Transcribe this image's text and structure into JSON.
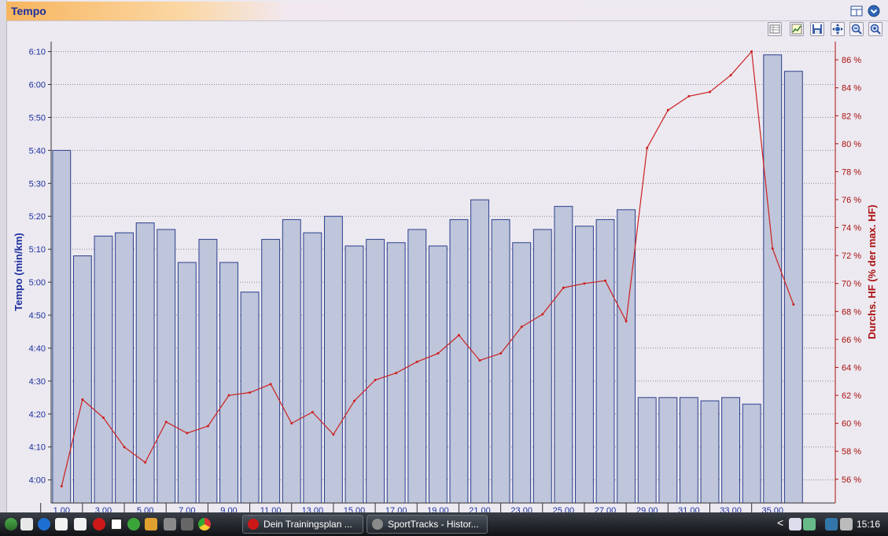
{
  "panel": {
    "title": "Tempo"
  },
  "colors": {
    "bar_fill": "#bfc5da",
    "bar_stroke": "#2a3f8e",
    "line": "#cc2020",
    "left_axis": "#1c2f9e",
    "right_axis": "#aa1010"
  },
  "chart_data": {
    "type": "bar+line",
    "x_tick_labels": [
      "1.00",
      "3.00",
      "5.00",
      "7.00",
      "9.00",
      "11.00",
      "13.00",
      "15.00",
      "17.00",
      "19.00",
      "21.00",
      "23.00",
      "25.00",
      "27.00",
      "29.00",
      "31.00",
      "33.00",
      "35.00"
    ],
    "y_left": {
      "label": "Tempo (min/km)",
      "ticks": [
        "4:00",
        "4:10",
        "4:20",
        "4:30",
        "4:40",
        "4:50",
        "5:00",
        "5:10",
        "5:20",
        "5:30",
        "5:40",
        "5:50",
        "6:00",
        "6:10"
      ],
      "range_seconds_per_km": [
        233,
        373
      ]
    },
    "y_right": {
      "label": "Durchs. HF (% der max. HF)",
      "ticks": [
        "56 %",
        "58 %",
        "60 %",
        "62 %",
        "64 %",
        "66 %",
        "68 %",
        "70 %",
        "72 %",
        "74 %",
        "76 %",
        "78 %",
        "80 %",
        "82 %",
        "84 %",
        "86 %"
      ],
      "range_percent": [
        54.3,
        87.3
      ]
    },
    "grid": true,
    "series": [
      {
        "name": "Tempo",
        "type": "bar",
        "axis": "left",
        "x": [
          1,
          2,
          3,
          4,
          5,
          6,
          7,
          8,
          9,
          10,
          11,
          12,
          13,
          14,
          15,
          16,
          17,
          18,
          19,
          20,
          21,
          22,
          23,
          24,
          25,
          26,
          27,
          28,
          29,
          30,
          31,
          32,
          33,
          34,
          35,
          36
        ],
        "values_seconds_per_km": [
          340,
          308,
          314,
          315,
          318,
          316,
          306,
          313,
          306,
          297,
          313,
          319,
          315,
          320,
          311,
          313,
          312,
          316,
          311,
          319,
          325,
          319,
          312,
          316,
          323,
          317,
          319,
          322,
          265,
          265,
          265,
          264,
          265,
          263,
          369,
          364
        ]
      },
      {
        "name": "Durchs. HF",
        "type": "line",
        "axis": "right",
        "x": [
          1,
          2,
          3,
          4,
          5,
          6,
          7,
          8,
          9,
          10,
          11,
          12,
          13,
          14,
          15,
          16,
          17,
          18,
          19,
          20,
          21,
          22,
          23,
          24,
          25,
          26,
          27,
          28,
          29,
          30,
          31,
          32,
          33,
          34,
          35,
          36
        ],
        "values_percent": [
          55.5,
          61.7,
          60.4,
          58.3,
          57.2,
          60.1,
          59.3,
          59.8,
          62.0,
          62.2,
          62.8,
          60.0,
          60.8,
          59.2,
          61.6,
          63.1,
          63.6,
          64.4,
          65.0,
          66.3,
          64.5,
          65.0,
          66.9,
          67.8,
          69.7,
          70.0,
          70.2,
          67.3,
          79.7,
          82.4,
          83.4,
          83.7,
          84.9,
          86.6,
          72.5,
          68.5
        ]
      }
    ]
  },
  "taskbar": {
    "tasks": [
      {
        "label": "Dein Trainingsplan ..."
      },
      {
        "label": "SportTracks - Histor..."
      }
    ],
    "clock": "15:16"
  }
}
